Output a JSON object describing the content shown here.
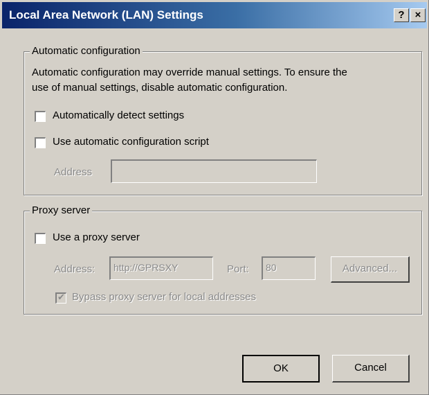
{
  "window": {
    "title": "Local Area Network (LAN) Settings",
    "help_label": "?",
    "close_label": "×"
  },
  "auto_config": {
    "legend": "Automatic configuration",
    "description_line1": "Automatic configuration may override manual settings.  To ensure the",
    "description_line2": "use of manual settings, disable automatic configuration.",
    "detect_settings": {
      "label": "Automatically detect settings",
      "checked": false
    },
    "use_script": {
      "label": "Use automatic configuration script",
      "checked": false
    },
    "address_label": "Address",
    "address_value": ""
  },
  "proxy": {
    "legend": "Proxy server",
    "use_proxy": {
      "label": "Use a proxy server",
      "checked": false
    },
    "address_label": "Address:",
    "address_value": "http://GPRSXY",
    "port_label": "Port:",
    "port_value": "80",
    "advanced_label": "Advanced...",
    "bypass": {
      "label": "Bypass proxy server for local addresses",
      "checked": true
    }
  },
  "buttons": {
    "ok": "OK",
    "cancel": "Cancel"
  }
}
